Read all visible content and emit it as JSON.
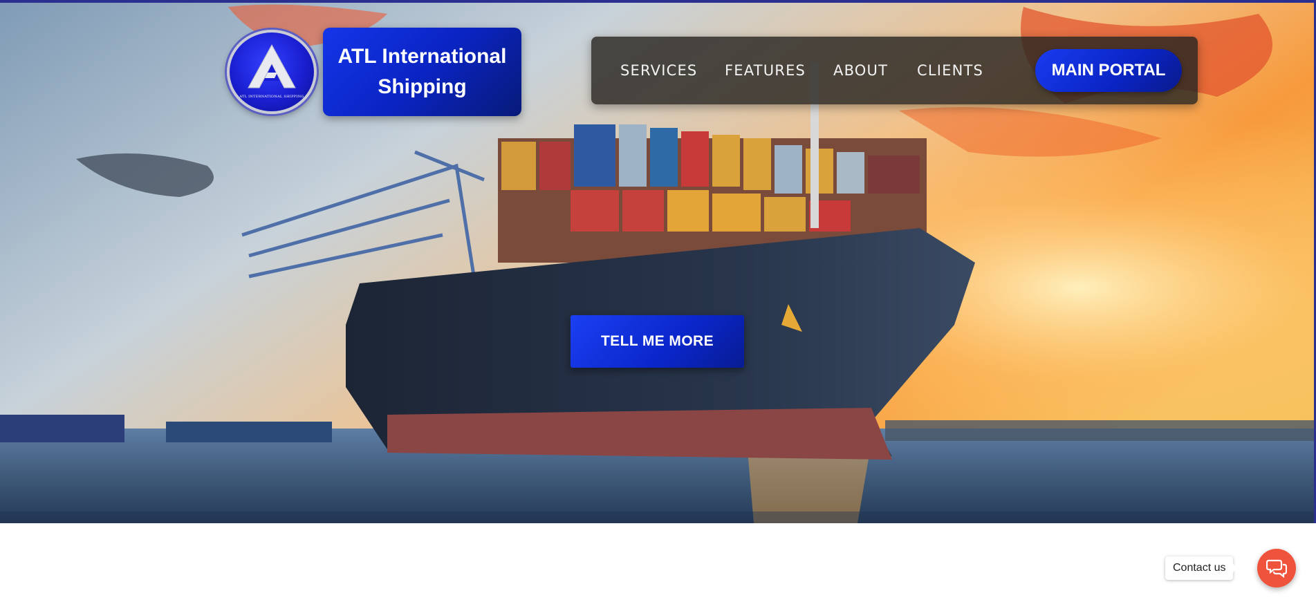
{
  "brand": {
    "logo_icon": "atl-triangle-logo-icon",
    "logo_caption": "ATL INTERNATIONAL SHIPPING",
    "title": "ATL International Shipping"
  },
  "nav": {
    "items": [
      {
        "label": "SERVICES"
      },
      {
        "label": "FEATURES"
      },
      {
        "label": "ABOUT"
      },
      {
        "label": "CLIENTS"
      }
    ],
    "portal_label": "MAIN PORTAL"
  },
  "hero": {
    "cta_label": "TELL ME MORE",
    "background": "container-ship-at-port-sunset-image"
  },
  "contact": {
    "label": "Contact us",
    "chat_icon": "chat-bubbles-icon"
  },
  "colors": {
    "accent_blue": "#0a24c4",
    "top_strip": "#2b2f8f",
    "nav_bg": "#28261f",
    "chat_orange": "#f0533c"
  }
}
